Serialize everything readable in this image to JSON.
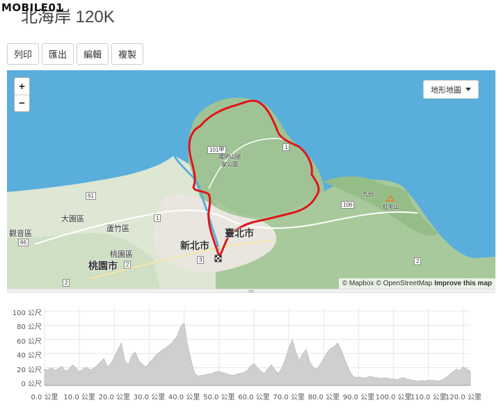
{
  "watermark": {
    "text": "MOBILE01",
    "logo": "mobile01-logo"
  },
  "route": {
    "title": "北海岸 120K"
  },
  "toolbar": {
    "print": "列印",
    "export": "匯出",
    "edit": "編輯",
    "copy": "複製"
  },
  "map": {
    "zoom_in": "+",
    "zoom_out": "−",
    "layer_select": "地形地圖",
    "attribution_mapbox": "© Mapbox",
    "attribution_osm": "© OpenStreetMap",
    "attribution_improve": "Improve this map",
    "route_color": "#e0141b",
    "sea_color": "#5aaedb",
    "labels": {
      "taipei": "臺北市",
      "new_taipei": "新北市",
      "taoyuan_city": "桃園市",
      "taoyuan_dist": "桃園區",
      "dayuan": "大園區",
      "luzhu": "蘆竹區",
      "guanyin": "觀音區",
      "jiufen": "九份",
      "hongmaoshan": "紅毛山",
      "yangmingshan": "陽明山國家公園",
      "road_101": "101甲"
    },
    "shields": {
      "s61": "61",
      "s66": "66",
      "s1a": "1",
      "s2a": "2",
      "s3": "3",
      "s106": "106",
      "s2b": "2",
      "s1b": "1",
      "s2c": "2"
    }
  },
  "chart_data": {
    "type": "area",
    "title": "",
    "xlabel": "",
    "ylabel": "",
    "x_unit": "公里",
    "y_unit": "公尺",
    "xlim": [
      0,
      122
    ],
    "ylim": [
      -5,
      105
    ],
    "x_ticks": [
      "0.0 公里",
      "10.0 公里",
      "20.0 公里",
      "30.0 公里",
      "40.0 公里",
      "50.0 公里",
      "60.0 公里",
      "70.0 公里",
      "80.0 公里",
      "90.0 公里",
      "100.0 公里",
      "110.0 公里",
      "120.0 公里"
    ],
    "y_ticks": [
      "100 公尺",
      "80 公尺",
      "60 公尺",
      "40 公尺",
      "20 公尺",
      "0 公尺"
    ],
    "grid": true,
    "fill_color": "#cfcfcf",
    "series": [
      {
        "x": [
          0,
          1,
          2,
          3,
          4,
          5,
          6,
          7,
          8,
          9,
          10,
          11,
          12,
          13,
          14,
          15,
          16,
          17,
          18,
          19,
          20,
          21,
          22,
          23,
          24,
          25,
          26,
          27,
          28,
          29,
          30,
          31,
          32,
          33,
          34,
          35,
          36,
          37,
          38,
          39,
          40,
          41,
          42,
          43,
          44,
          45,
          46,
          47,
          48,
          49,
          50,
          51,
          52,
          53,
          54,
          55,
          56,
          57,
          58,
          59,
          60,
          61,
          62,
          63,
          64,
          65,
          66,
          67,
          68,
          69,
          70,
          71,
          72,
          73,
          74,
          75,
          76,
          77,
          78,
          79,
          80,
          81,
          82,
          83,
          84,
          85,
          86,
          87,
          88,
          89,
          90,
          91,
          92,
          93,
          94,
          95,
          96,
          97,
          98,
          99,
          100,
          101,
          102,
          103,
          104,
          105,
          106,
          107,
          108,
          109,
          110,
          111,
          112,
          113,
          114,
          115,
          116,
          117,
          118,
          119,
          120,
          121,
          122
        ],
        "values": [
          18,
          17,
          20,
          16,
          19,
          22,
          15,
          18,
          24,
          20,
          14,
          18,
          21,
          17,
          19,
          23,
          28,
          33,
          21,
          26,
          35,
          45,
          55,
          30,
          24,
          37,
          42,
          30,
          25,
          21,
          27,
          32,
          38,
          42,
          46,
          49,
          53,
          58,
          65,
          78,
          83,
          52,
          30,
          12,
          8,
          9,
          10,
          11,
          12,
          14,
          15,
          13,
          12,
          10,
          9,
          11,
          12,
          13,
          16,
          22,
          26,
          20,
          15,
          12,
          19,
          24,
          17,
          12,
          20,
          32,
          48,
          60,
          42,
          30,
          40,
          46,
          28,
          20,
          18,
          25,
          33,
          42,
          47,
          50,
          55,
          45,
          32,
          20,
          10,
          6,
          7,
          6,
          5,
          8,
          7,
          6,
          5,
          5,
          6,
          4,
          4,
          3,
          5,
          6,
          4,
          3,
          2,
          1,
          2,
          1,
          3,
          2,
          2,
          1,
          3,
          6,
          10,
          14,
          18,
          16,
          21,
          18,
          15
        ]
      }
    ]
  }
}
